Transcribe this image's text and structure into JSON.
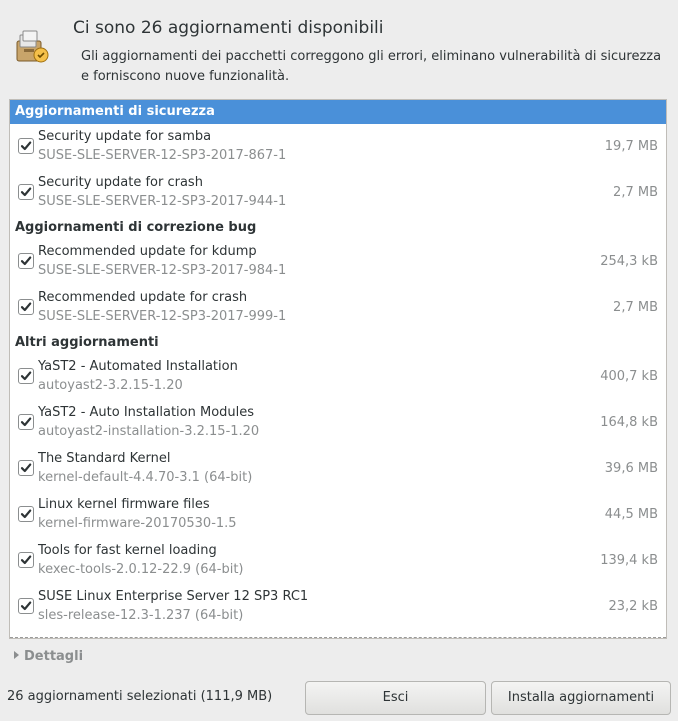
{
  "header": {
    "title": "Ci sono 26 aggiornamenti disponibili",
    "description": "Gli aggiornamenti dei pacchetti correggono gli errori, eliminano vulnerabilità di sicurezza e forniscono nuove funzionalità.",
    "icon": "software-update-icon"
  },
  "sections": [
    {
      "label": "Aggiornamenti di sicurezza",
      "items": [
        {
          "title": "Security update for samba",
          "subtitle": "SUSE-SLE-SERVER-12-SP3-2017-867-1",
          "size": "19,7 MB",
          "checked": true
        },
        {
          "title": "Security update for crash",
          "subtitle": "SUSE-SLE-SERVER-12-SP3-2017-944-1",
          "size": "2,7 MB",
          "checked": true
        }
      ]
    },
    {
      "label": "Aggiornamenti di correzione bug",
      "items": [
        {
          "title": "Recommended update for kdump",
          "subtitle": "SUSE-SLE-SERVER-12-SP3-2017-984-1",
          "size": "254,3 kB",
          "checked": true
        },
        {
          "title": "Recommended update for crash",
          "subtitle": "SUSE-SLE-SERVER-12-SP3-2017-999-1",
          "size": "2,7 MB",
          "checked": true
        }
      ]
    },
    {
      "label": "Altri aggiornamenti",
      "items": [
        {
          "title": "YaST2 - Automated Installation",
          "subtitle": "autoyast2-3.2.15-1.20",
          "size": "400,7 kB",
          "checked": true
        },
        {
          "title": "YaST2 - Auto Installation Modules",
          "subtitle": "autoyast2-installation-3.2.15-1.20",
          "size": "164,8 kB",
          "checked": true
        },
        {
          "title": "The Standard Kernel",
          "subtitle": "kernel-default-4.4.70-3.1 (64-bit)",
          "size": "39,6 MB",
          "checked": true
        },
        {
          "title": "Linux kernel firmware files",
          "subtitle": "kernel-firmware-20170530-1.5",
          "size": "44,5 MB",
          "checked": true
        },
        {
          "title": "Tools for fast kernel loading",
          "subtitle": "kexec-tools-2.0.12-22.9 (64-bit)",
          "size": "139,4 kB",
          "checked": true
        },
        {
          "title": "SUSE Linux Enterprise Server 12 SP3 RC1",
          "subtitle": "sles-release-12.3-1.237 (64-bit)",
          "size": "23,2 kB",
          "checked": true
        }
      ]
    }
  ],
  "details_label": "Dettagli",
  "status_text": "26 aggiornamenti selezionati (111,9 MB)",
  "buttons": {
    "cancel": "Esci",
    "install": "Installa aggiornamenti"
  },
  "colors": {
    "selection": "#4a90d9",
    "background": "#ededed"
  }
}
